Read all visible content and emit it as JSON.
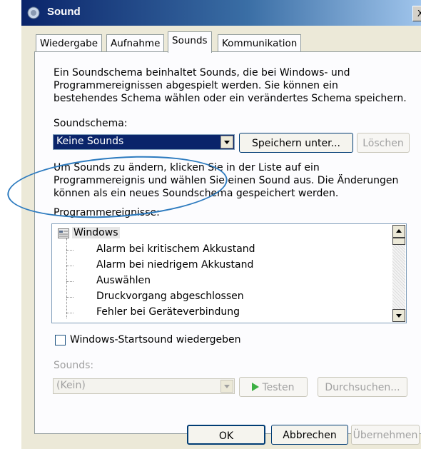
{
  "window": {
    "title": "Sound",
    "close_label": "X"
  },
  "tabs": [
    {
      "label": "Wiedergabe",
      "active": false
    },
    {
      "label": "Aufnahme",
      "active": false
    },
    {
      "label": "Sounds",
      "active": true
    },
    {
      "label": "Kommunikation",
      "active": false
    }
  ],
  "sounds_tab": {
    "intro_lines": [
      "Ein Soundschema beinhaltet Sounds, die bei Windows- und",
      "Programmereignissen abgespielt werden. Sie können ein",
      "bestehendes Schema wählen oder ein verändertes Schema speichern."
    ],
    "scheme_label": "Soundschema:",
    "scheme_value": "Keine Sounds",
    "save_as_label": "Speichern unter...",
    "delete_label": "Löschen",
    "help_lines": [
      "Um Sounds zu ändern, klicken Sie in der Liste auf ein",
      "Programmereignis und wählen Sie einen Sound aus. Die Änderungen",
      "können als ein neues Soundschema gespeichert werden."
    ],
    "events_label": "Programmereignisse:",
    "events": {
      "root": "Windows",
      "items": [
        "Alarm bei kritischem Akkustand",
        "Alarm bei niedrigem Akkustand",
        "Auswählen",
        "Druckvorgang abgeschlossen",
        "Fehler bei Geräteverbindung"
      ]
    },
    "startup_checkbox_label": "Windows-Startsound wiedergeben",
    "startup_checked": false,
    "sounds_label": "Sounds:",
    "sounds_value": "(Kein)",
    "test_label": "Testen",
    "browse_label": "Durchsuchen..."
  },
  "footer": {
    "ok_label": "OK",
    "cancel_label": "Abbrechen",
    "apply_label": "Übernehmen"
  },
  "colors": {
    "title_gradient_start": "#0a246a",
    "selection": "#0a246a",
    "annotation": "#2d7bbf",
    "play_icon": "#3cb043"
  }
}
